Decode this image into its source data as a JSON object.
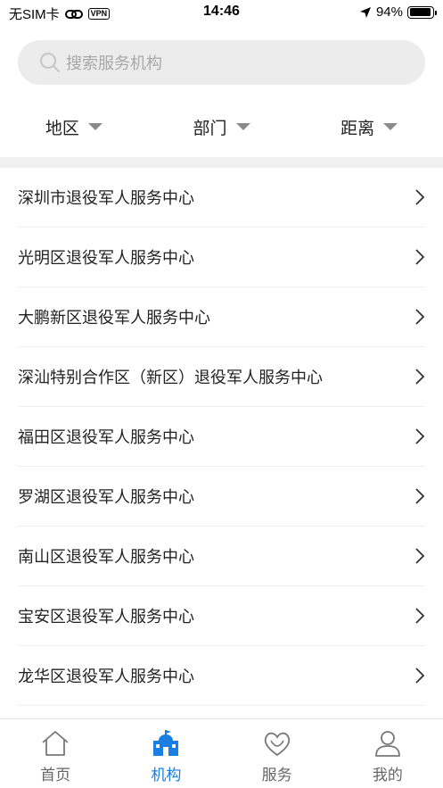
{
  "status_bar": {
    "carrier": "无SIM卡",
    "vpn": "VPN",
    "time": "14:46",
    "battery": "94%",
    "battery_level": 0.94
  },
  "search": {
    "placeholder": "搜索服务机构",
    "icon": "search-icon"
  },
  "filters": [
    {
      "label": "地区"
    },
    {
      "label": "部门"
    },
    {
      "label": "距离"
    }
  ],
  "org_list": [
    "深圳市退役军人服务中心",
    "光明区退役军人服务中心",
    "大鹏新区退役军人服务中心",
    "深汕特别合作区（新区）退役军人服务中心",
    "福田区退役军人服务中心",
    "罗湖区退役军人服务中心",
    "南山区退役军人服务中心",
    "宝安区退役军人服务中心",
    "龙华区退役军人服务中心"
  ],
  "tabbar": {
    "items": [
      {
        "label": "首页",
        "icon": "home-icon",
        "active": false
      },
      {
        "label": "机构",
        "icon": "institution-icon",
        "active": true
      },
      {
        "label": "服务",
        "icon": "service-heart-icon",
        "active": false
      },
      {
        "label": "我的",
        "icon": "profile-icon",
        "active": false
      }
    ]
  },
  "colors": {
    "accent": "#1a7fe0",
    "inactive": "#666666",
    "search_bg": "#ececec"
  }
}
